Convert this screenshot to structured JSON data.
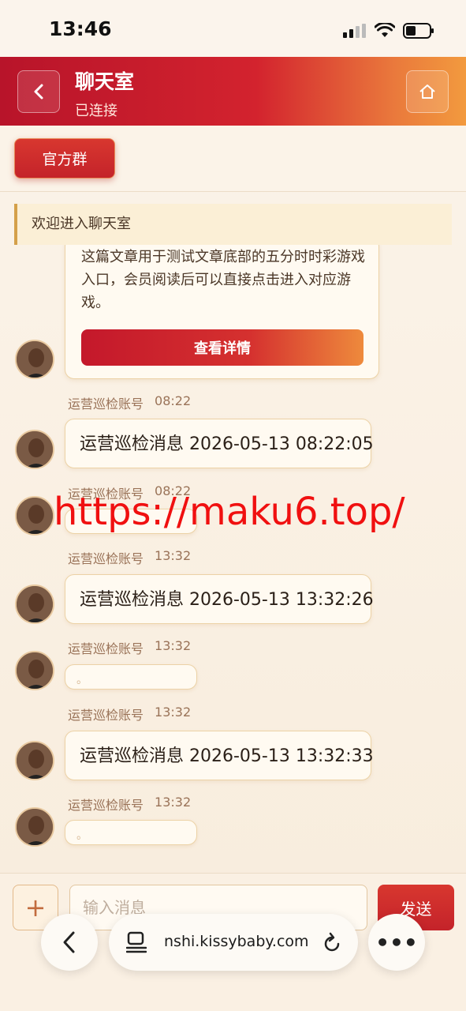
{
  "status_bar": {
    "time": "13:46"
  },
  "header": {
    "title": "聊天室",
    "subtitle": "已连接",
    "back_icon": "chevron-left-icon",
    "home_icon": "home-icon"
  },
  "group_button": "官方群",
  "notice": "欢迎进入聊天室",
  "card": {
    "text": "这篇文章用于测试文章底部的五分时时彩游戏入口，会员阅读后可以直接点击进入对应游戏。",
    "button": "查看详情"
  },
  "messages": [
    {
      "sender": "运营巡检账号",
      "time": "08:22",
      "text": "运营巡检消息 2026-05-13 08:22:05"
    },
    {
      "sender": "运营巡检账号",
      "time": "08:22",
      "text": ""
    },
    {
      "sender": "运营巡检账号",
      "time": "13:32",
      "text": "运营巡检消息 2026-05-13 13:32:26"
    },
    {
      "sender": "运营巡检账号",
      "time": "13:32",
      "text": "。"
    },
    {
      "sender": "运营巡检账号",
      "time": "13:32",
      "text": "运营巡检消息 2026-05-13 13:32:33"
    },
    {
      "sender": "运营巡检账号",
      "time": "13:32",
      "text": "。"
    }
  ],
  "watermark": "https://maku6.top/",
  "input": {
    "placeholder": "输入消息",
    "send": "发送",
    "plus": "+"
  },
  "browser": {
    "url": "nshi.kissybaby.com",
    "more": "•••"
  }
}
